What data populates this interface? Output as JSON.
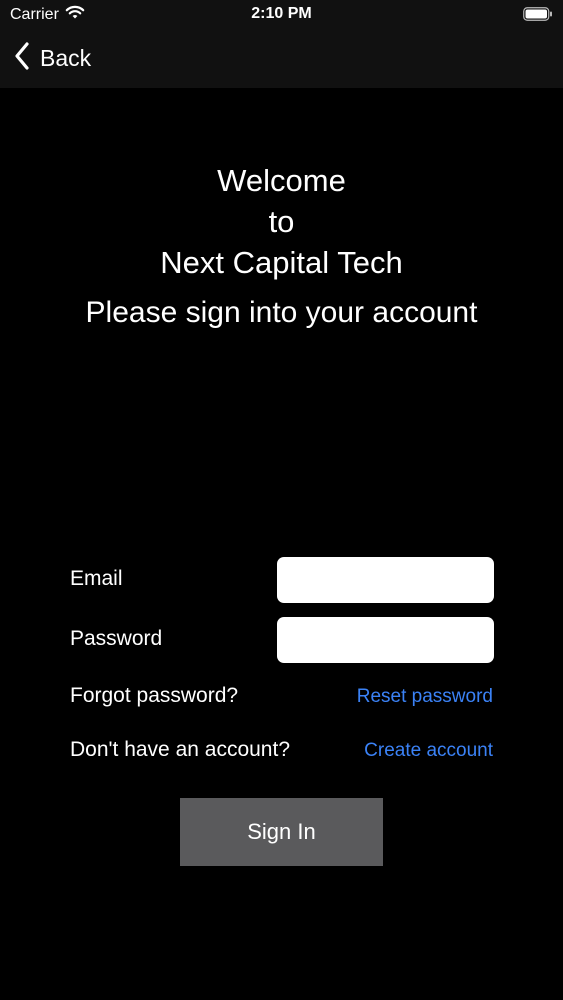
{
  "status_bar": {
    "carrier": "Carrier",
    "time": "2:10 PM",
    "icons": [
      "wifi-icon",
      "battery-icon"
    ]
  },
  "nav": {
    "back_label": "Back",
    "icon": "chevron-left-icon"
  },
  "welcome": {
    "line1": "Welcome",
    "line2": "to",
    "line3": "Next Capital Tech"
  },
  "subtitle": "Please sign into your account",
  "form": {
    "email_label": "Email",
    "email_value": "",
    "password_label": "Password",
    "password_value": "",
    "forgot_label": "Forgot password?",
    "reset_link": "Reset password",
    "no_account_label": "Don't have an account?",
    "create_link": "Create account",
    "sign_in_label": "Sign In"
  },
  "colors": {
    "background": "#000000",
    "bar": "#111111",
    "link": "#3b82f6",
    "button": "#5a5a5c",
    "field": "#ffffff"
  }
}
